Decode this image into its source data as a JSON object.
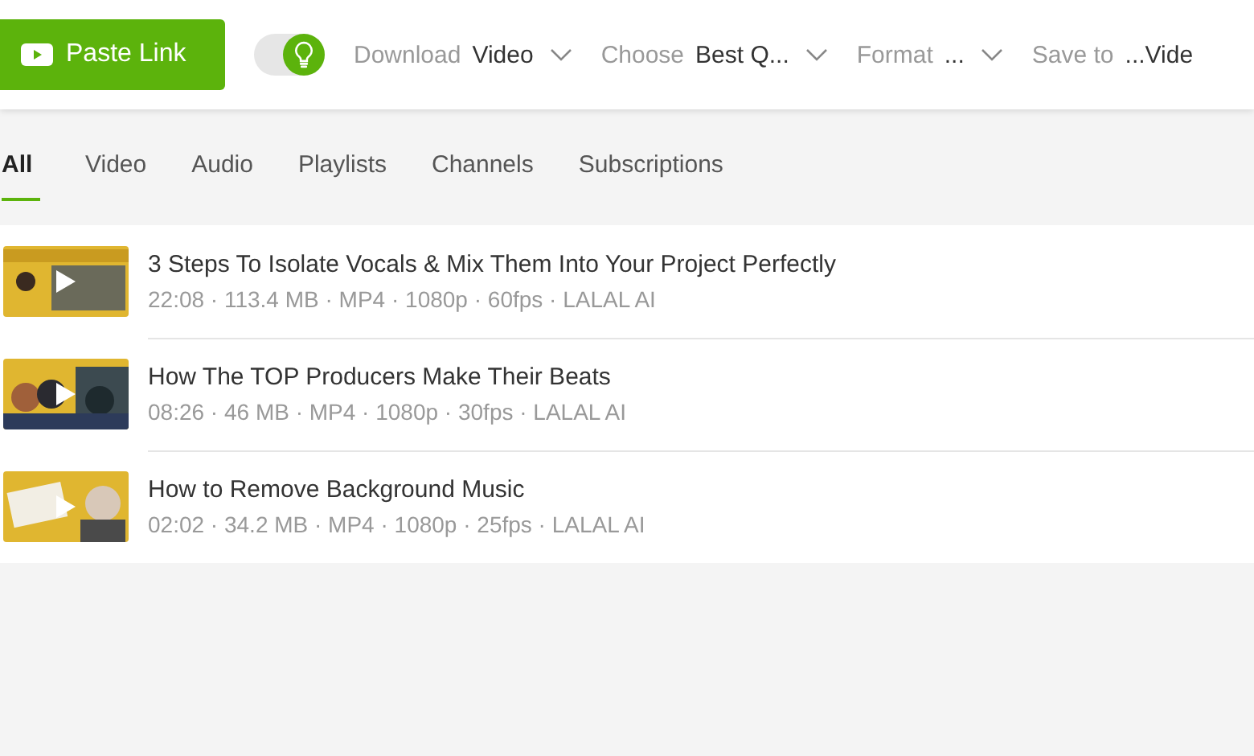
{
  "toolbar": {
    "paste_button": "Paste Link",
    "toggle": {
      "on": true
    },
    "dropdowns": [
      {
        "label": "Download",
        "value": "Video",
        "chevron": true
      },
      {
        "label": "Choose",
        "value": "Best Q...",
        "chevron": true
      },
      {
        "label": "Format",
        "value": "...",
        "chevron": true
      },
      {
        "label": "Save to",
        "value": "...Vide",
        "chevron": false
      }
    ]
  },
  "tabs": [
    {
      "label": "All",
      "selected": true
    },
    {
      "label": "Video",
      "selected": false
    },
    {
      "label": "Audio",
      "selected": false
    },
    {
      "label": "Playlists",
      "selected": false
    },
    {
      "label": "Channels",
      "selected": false
    },
    {
      "label": "Subscriptions",
      "selected": false
    }
  ],
  "items": [
    {
      "title": "3 Steps To Isolate Vocals & Mix Them Into Your Project Perfectly",
      "meta": "22:08 · 113.4 MB · MP4 · 1080p · 60fps · LALAL AI"
    },
    {
      "title": "How The TOP Producers Make Their Beats",
      "meta": "08:26 · 46 MB · MP4 · 1080p · 30fps · LALAL AI"
    },
    {
      "title": "How to Remove Background Music",
      "meta": "02:02 · 34.2 MB · MP4 · 1080p · 25fps · LALAL AI"
    }
  ]
}
